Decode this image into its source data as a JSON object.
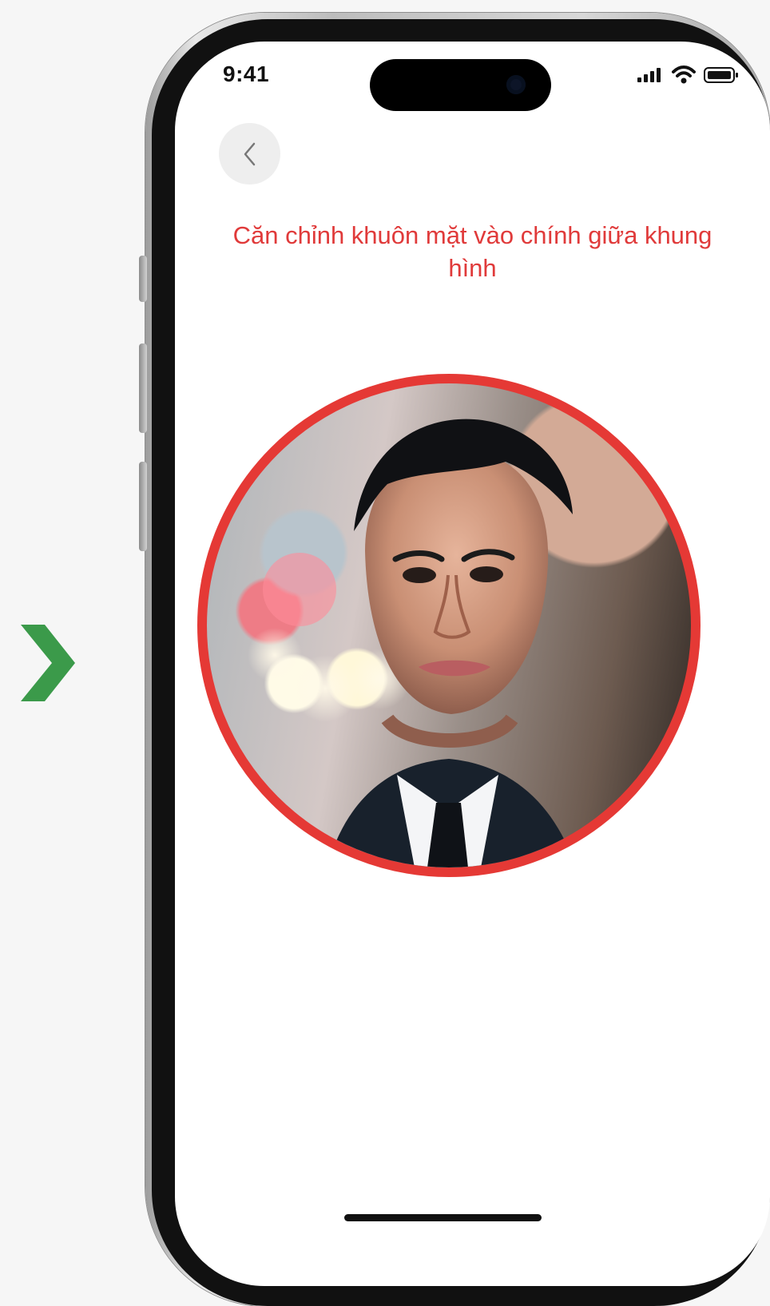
{
  "status_bar": {
    "time": "9:41",
    "signal_icon": "signal-icon",
    "wifi_icon": "wifi-icon",
    "battery_icon": "battery-icon"
  },
  "navigation": {
    "back_icon": "chevron-left-icon"
  },
  "instruction": {
    "text": "Căn chỉnh khuôn mặt vào chính giữa khung hình"
  },
  "face_capture": {
    "frame_color": "#e53935"
  },
  "outer_indicator": {
    "icon": "chevron-right-icon",
    "color": "#3b9a4a"
  }
}
